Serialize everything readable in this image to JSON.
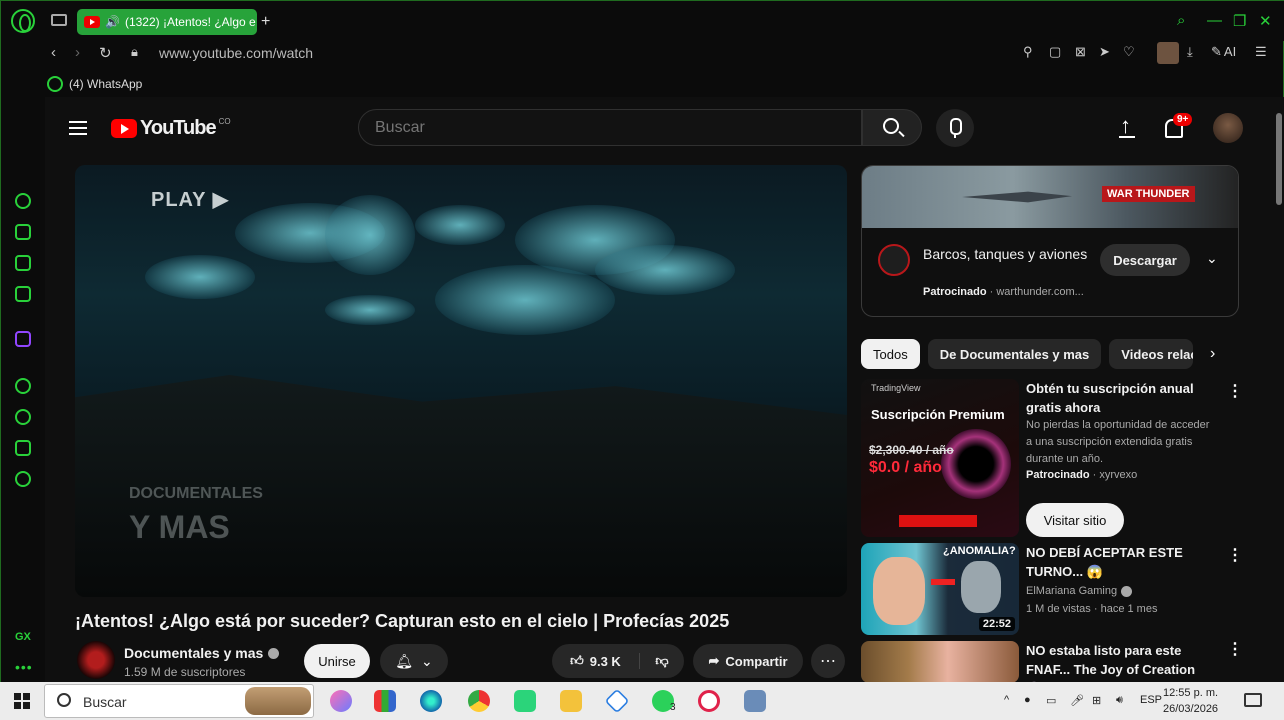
{
  "browser": {
    "tab_title": "(1322) ¡Atentos! ¿Algo e",
    "url": "www.youtube.com/watch",
    "ai_label": "AI",
    "bookmark": "(4) WhatsApp",
    "sidebar_label_gx": "GX",
    "accent_color": "#29d13a"
  },
  "youtube": {
    "logo_text": "YouTube",
    "country_code": "CO",
    "search_placeholder": "Buscar",
    "notifications_badge": "9+"
  },
  "video": {
    "overlay_play": "PLAY ▶",
    "watermark_line1": "DOCUMENTALES",
    "watermark_line2": "Y MAS",
    "title": "¡Atentos! ¿Algo está por suceder? Capturan esto en el cielo | Profecías 2025",
    "channel_name": "Documentales y mas",
    "subscribers": "1.59 M de suscriptores",
    "join_label": "Unirse",
    "likes": "9.3 K",
    "share_label": "Compartir"
  },
  "ad_sponsored": {
    "banner_text": "WAR THUNDER",
    "title": "Barcos, tanques y aviones",
    "sponsored_label": "Patrocinado",
    "domain": "warthunder.com...",
    "download_label": "Descargar"
  },
  "chips": [
    "Todos",
    "De Documentales y mas",
    "Videos relaci"
  ],
  "sidebar_items": [
    {
      "title": "Obtén tu suscripción anual gratis ahora",
      "description": "No pierdas la oportunidad de acceder a una suscripción extendida gratis durante un año.",
      "sponsored_label": "Patrocinado",
      "advertiser": "xyrvexo",
      "button_label": "Visitar sitio",
      "thumb_brand": "TradingView",
      "thumb_headline": "Suscripción Premium",
      "thumb_old_price": "$2,300.40 / año",
      "thumb_new_price": "$0.0 / año"
    },
    {
      "title": "NO DEBÍ ACEPTAR ESTE TURNO... 😱",
      "channel": "ElMariana Gaming",
      "meta": "1 M de vistas · hace 1 mes",
      "duration": "22:52",
      "thumb_tag": "¿ANOMALIA?"
    },
    {
      "title": "NO estaba listo para este FNAF... The Joy of Creation 😨"
    }
  ],
  "taskbar": {
    "search_placeholder": "Buscar",
    "language": "ESP",
    "time": "12:55 p. m.",
    "date": "26/03/2026",
    "whatsapp_badge": "3"
  }
}
